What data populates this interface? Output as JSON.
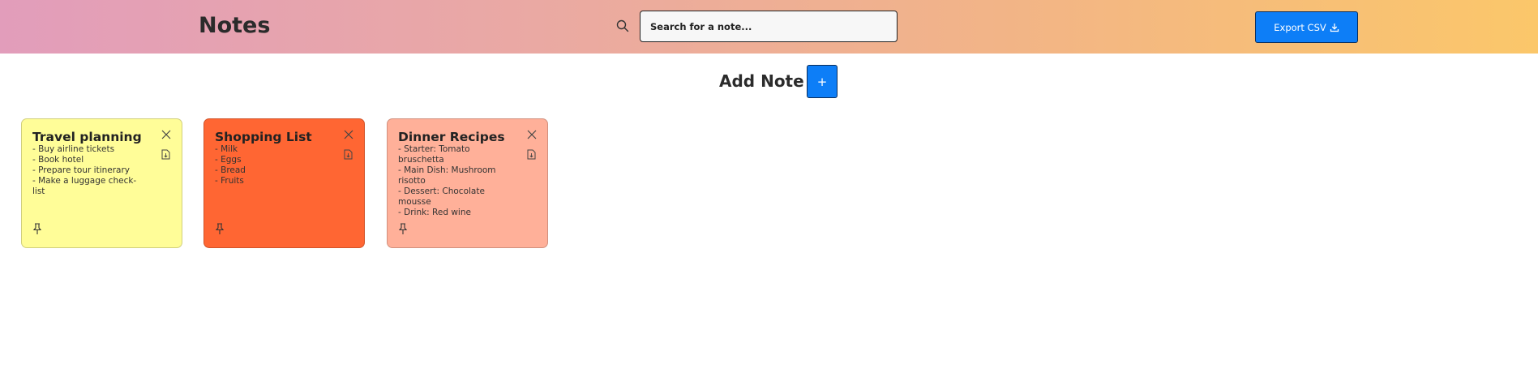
{
  "header": {
    "title": "Notes",
    "search": {
      "placeholder": "Search for a note...",
      "value": "",
      "icon": "search-icon"
    },
    "export_label": "Export CSV",
    "export_icon": "download-icon"
  },
  "add_note": {
    "label": "Add Note",
    "button_label": "+"
  },
  "colors": {
    "header_gradient": [
      "#e29dbb",
      "#fbc76a"
    ],
    "accent_button": "#0d7ef7"
  },
  "notes": [
    {
      "title": "Travel planning",
      "color": "#fffd98",
      "lines": [
        "- Buy airline tickets",
        "- Book hotel",
        "- Prepare tour itinerary",
        "- Make a luggage check-list"
      ]
    },
    {
      "title": "Shopping List",
      "color": "#ff6633",
      "lines": [
        "- Milk",
        "- Eggs",
        "- Bread",
        "- Fruits"
      ]
    },
    {
      "title": "Dinner Recipes",
      "color": "#ffb099",
      "lines": [
        "- Starter: Tomato bruschetta",
        "- Main Dish: Mushroom risotto",
        "- Dessert: Chocolate mousse",
        "- Drink: Red wine"
      ]
    }
  ]
}
